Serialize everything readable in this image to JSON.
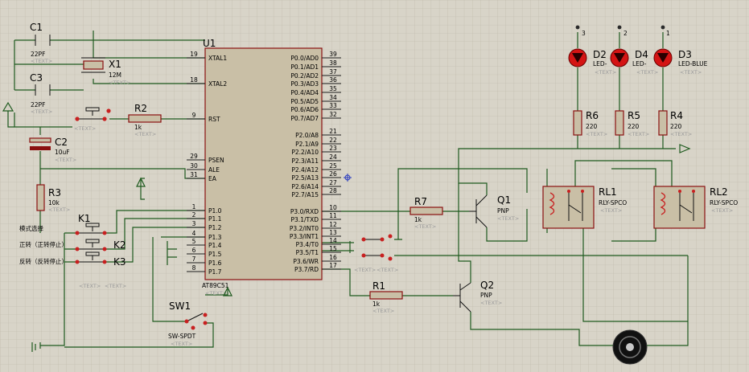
{
  "crystal": {
    "c1": {
      "ref": "C1",
      "value": "22PF"
    },
    "c3": {
      "ref": "C3",
      "value": "22PF"
    },
    "x1": {
      "ref": "X1",
      "value": "12M"
    }
  },
  "reset": {
    "r2": {
      "ref": "R2",
      "value": "1k"
    },
    "c2": {
      "ref": "C2",
      "value": "10uF"
    },
    "r3": {
      "ref": "R3",
      "value": "10k"
    }
  },
  "keys": {
    "k1": {
      "ref": "K1",
      "label": "模式选择"
    },
    "k2": {
      "ref": "K2",
      "label": "正转（正转停止）"
    },
    "k3": {
      "ref": "K3",
      "label": "反转（反转停止）"
    }
  },
  "mcu": {
    "ref": "U1",
    "part": "AT89C51",
    "left_pins": [
      {
        "num": "19",
        "name": "XTAL1"
      },
      {
        "num": "18",
        "name": "XTAL2"
      },
      {
        "num": "9",
        "name": "RST"
      },
      {
        "num": "29",
        "name": "PSEN"
      },
      {
        "num": "30",
        "name": "ALE"
      },
      {
        "num": "31",
        "name": "EA"
      },
      {
        "num": "1",
        "name": "P1.0"
      },
      {
        "num": "2",
        "name": "P1.1"
      },
      {
        "num": "3",
        "name": "P1.2"
      },
      {
        "num": "4",
        "name": "P1.3"
      },
      {
        "num": "5",
        "name": "P1.4"
      },
      {
        "num": "6",
        "name": "P1.5"
      },
      {
        "num": "7",
        "name": "P1.6"
      },
      {
        "num": "8",
        "name": "P1.7"
      }
    ],
    "right_pins": [
      {
        "num": "39",
        "name": "P0.0/AD0"
      },
      {
        "num": "38",
        "name": "P0.1/AD1"
      },
      {
        "num": "37",
        "name": "P0.2/AD2"
      },
      {
        "num": "36",
        "name": "P0.3/AD3"
      },
      {
        "num": "35",
        "name": "P0.4/AD4"
      },
      {
        "num": "34",
        "name": "P0.5/AD5"
      },
      {
        "num": "33",
        "name": "P0.6/AD6"
      },
      {
        "num": "32",
        "name": "P0.7/AD7"
      },
      {
        "num": "21",
        "name": "P2.0/A8"
      },
      {
        "num": "22",
        "name": "P2.1/A9"
      },
      {
        "num": "23",
        "name": "P2.2/A10"
      },
      {
        "num": "24",
        "name": "P2.3/A11"
      },
      {
        "num": "25",
        "name": "P2.4/A12"
      },
      {
        "num": "26",
        "name": "P2.5/A13"
      },
      {
        "num": "27",
        "name": "P2.6/A14"
      },
      {
        "num": "28",
        "name": "P2.7/A15"
      },
      {
        "num": "10",
        "name": "P3.0/RXD"
      },
      {
        "num": "11",
        "name": "P3.1/TXD"
      },
      {
        "num": "12",
        "name": "P3.2/INT0"
      },
      {
        "num": "13",
        "name": "P3.3/INT1"
      },
      {
        "num": "14",
        "name": "P3.4/T0"
      },
      {
        "num": "15",
        "name": "P3.5/T1"
      },
      {
        "num": "16",
        "name": "P3.6/WR"
      },
      {
        "num": "17",
        "name": "P3.7/RD"
      }
    ]
  },
  "switch": {
    "ref": "SW1",
    "part": "SW-SPDT"
  },
  "drivers": {
    "r7": {
      "ref": "R7",
      "value": "1k"
    },
    "r1": {
      "ref": "R1",
      "value": "1k"
    },
    "q1": {
      "ref": "Q1",
      "part": "PNP"
    },
    "q2": {
      "ref": "Q2",
      "part": "PNP"
    }
  },
  "relays": {
    "rl1": {
      "ref": "RL1",
      "part": "RLY-SPCO"
    },
    "rl2": {
      "ref": "RL2",
      "part": "RLY-SPCO"
    }
  },
  "leds": [
    {
      "ref": "D2",
      "part": "LED-",
      "pin": "3"
    },
    {
      "ref": "D4",
      "part": "LED-",
      "pin": "2"
    },
    {
      "ref": "D3",
      "part": "LED-BLUE",
      "pin": "1"
    }
  ],
  "led_resistors": [
    {
      "ref": "R6",
      "value": "220"
    },
    {
      "ref": "R5",
      "value": "220"
    },
    {
      "ref": "R4",
      "value": "220"
    }
  ],
  "text_placeholder": "<TEXT>",
  "colors": {
    "background": "#d8d4c8",
    "grid": "#bcb7a9",
    "wire": "#1e5a1e",
    "part": "#8a1010",
    "part_fill": "#c9bfa6",
    "led": "#d41414"
  }
}
